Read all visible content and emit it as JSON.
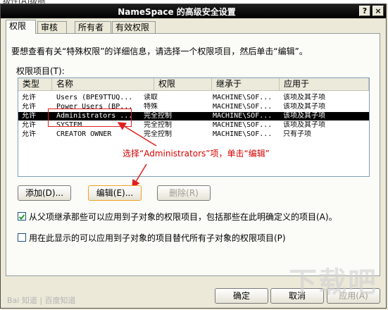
{
  "window": {
    "title": "NameSpace 的高级安全设置"
  },
  "top_partial": "级性(A)级响",
  "titlebar_buttons": {
    "help": "?",
    "close": "×"
  },
  "tabs": [
    "权限",
    "审核",
    "所有者",
    "有效权限"
  ],
  "description": "要想查看有关“特殊权限”的详细信息，请选择一个权限项目，然后单击“编辑”。",
  "list_label": "权限项目(T):",
  "columns": [
    "类型",
    "名称",
    "权限",
    "继承于",
    "应用于"
  ],
  "rows": [
    {
      "type": "允许",
      "name": "Users (BPE9TTUQ...",
      "perm": "读取",
      "from": "MACHINE\\SOF...",
      "applies": "该项及其子项"
    },
    {
      "type": "允许",
      "name": "Power Users (BP...",
      "perm": "特殊",
      "from": "MACHINE\\SOF...",
      "applies": "该项及其子项"
    },
    {
      "type": "允许",
      "name": "Administrators ...",
      "perm": "完全控制",
      "from": "MACHINE\\SOF...",
      "applies": "该项及其子项"
    },
    {
      "type": "允许",
      "name": "SYSTEM",
      "perm": "完全控制",
      "from": "MACHINE\\SOF...",
      "applies": "该项及其子项"
    },
    {
      "type": "允许",
      "name": "CREATOR OWNER",
      "perm": "完全控制",
      "from": "MACHINE\\SOF...",
      "applies": "只有子项"
    }
  ],
  "annotation": "选择“Administrators”项，单击“编辑”",
  "buttons": {
    "add": "添加(D)...",
    "edit": "编辑(E)...",
    "remove": "删除(R)"
  },
  "checkbox1": {
    "label": "从父项继承那些可以应用到子对象的权限项目，包括那些在此明确定义的项目(A)。",
    "checked": true
  },
  "checkbox2": {
    "label": "用在此显示的可以应用到子对象的项目替代所有子对象的权限项目(P)",
    "checked": false
  },
  "footer": {
    "ok": "确定",
    "cancel": "取消",
    "apply": "应用(A)"
  },
  "watermark": {
    "left": "Bai 知道 | 百度知道",
    "right": "下载吧"
  }
}
